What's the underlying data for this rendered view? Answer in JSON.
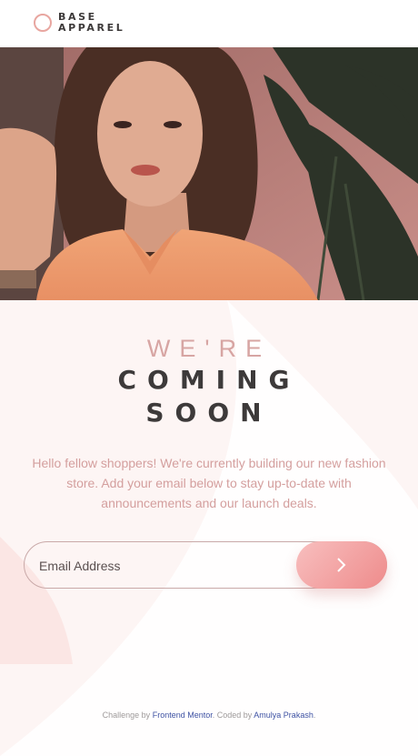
{
  "brand": {
    "line1": "BASE",
    "line2": "APPAREL",
    "icon": "circle-logo-icon"
  },
  "hero": {
    "alt": "woman in orange shirt",
    "colors": {
      "skin": "#d9a48c",
      "shirt": "#f3a67a",
      "wall": "#c88b85"
    }
  },
  "headline": {
    "line1": "WE'RE",
    "line2": "COMING",
    "line3": "SOON"
  },
  "description": "Hello fellow shoppers! We're currently building our new fashion store. Add your email below to stay up-to-date with announcements and our launch deals.",
  "form": {
    "placeholder": "Email Address",
    "submit_icon": "arrow-right-icon"
  },
  "footer": {
    "prefix": "Challenge by",
    "link1": "Frontend Mentor",
    "middle": ". Coded by",
    "link2": "Amulya Prakash",
    "suffix": "."
  },
  "colors": {
    "accent": "#ee8b8b",
    "text_dark": "#3d3a3a",
    "text_light": "#d49f9e"
  }
}
